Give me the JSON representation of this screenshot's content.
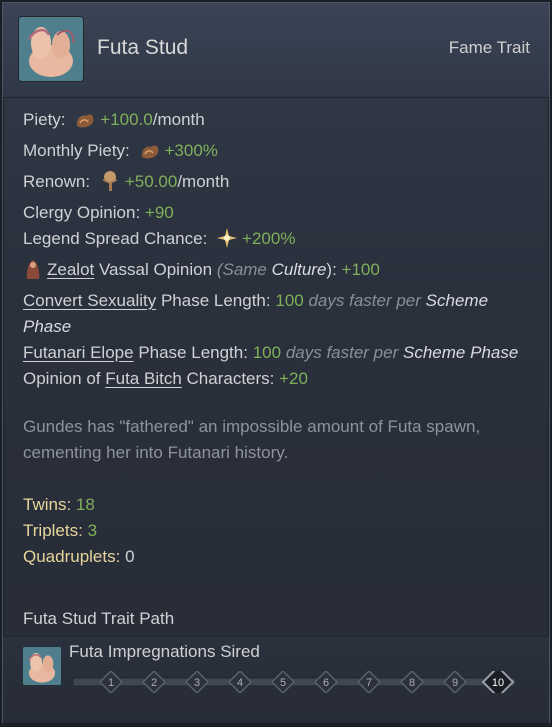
{
  "trait": {
    "name": "Futa Stud",
    "type": "Fame Trait",
    "icon": "futa-trait-portrait-icon"
  },
  "effects": {
    "piety": {
      "label": "Piety:",
      "value": "+100.0",
      "suffix": "/month",
      "icon": "piety-icon"
    },
    "monthly_piety": {
      "label": "Monthly Piety:",
      "value": "+300%",
      "icon": "piety-icon"
    },
    "renown": {
      "label": "Renown:",
      "value": "+50.00",
      "suffix": "/month",
      "icon": "renown-tree-icon"
    },
    "clergy": {
      "label": "Clergy Opinion:",
      "value": "+90"
    },
    "legend": {
      "label": "Legend Spread Chance:",
      "value": "+200%",
      "icon": "legend-star-icon"
    },
    "vassal": {
      "prefix_link": "Zealot",
      "label": "Vassal Opinion",
      "paren_open": "(Same ",
      "paren_word": "Culture",
      "paren_close": "):",
      "value": "+100",
      "icon": "zealot-icon"
    },
    "convert": {
      "link": "Convert Sexuality",
      "label": "Phase Length:",
      "value": "100",
      "faster": "days faster per",
      "scheme": "Scheme",
      "phase": "Phase"
    },
    "elope": {
      "link": "Futanari Elope",
      "label": "Phase Length:",
      "value": "100",
      "faster": "days faster per",
      "scheme": "Scheme",
      "phase": "Phase"
    },
    "opinion": {
      "prefix": "Opinion of",
      "link": "Futa Bitch",
      "label": "Characters:",
      "value": "+20"
    }
  },
  "description": "Gundes has \"fathered\" an impossible amount of Futa spawn, cementing her into Futanari history.",
  "counts": {
    "twins": {
      "label": "Twins:",
      "value": "18"
    },
    "triplets": {
      "label": "Triplets:",
      "value": "3"
    },
    "quadruplets": {
      "label": "Quadruplets:",
      "value": "0"
    }
  },
  "path": {
    "title": "Futa Stud Trait Path",
    "label": "Futa Impregnations Sired",
    "levels": [
      "1",
      "2",
      "3",
      "4",
      "5",
      "6",
      "7",
      "8",
      "9",
      "10"
    ],
    "current_level": "10"
  },
  "colors": {
    "positive": "#7fb05a",
    "gold": "#e6d59a",
    "text": "#cfd1d4",
    "muted": "#8a8f98"
  }
}
